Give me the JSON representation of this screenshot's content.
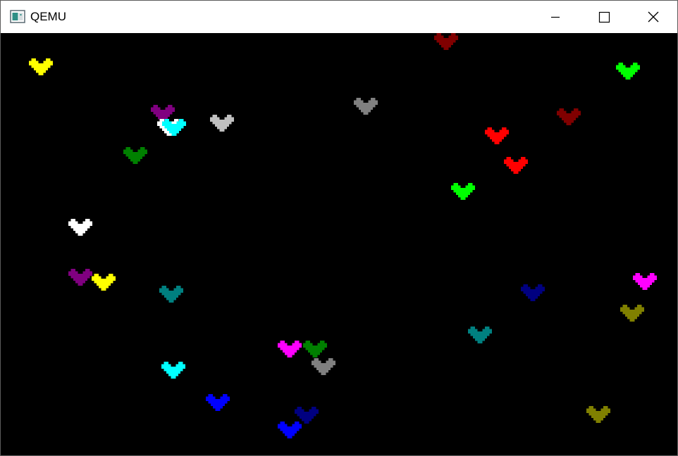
{
  "window": {
    "title": "QEMU",
    "icon": "qemu-app-icon",
    "controls": {
      "minimize_icon": "minimize-icon",
      "maximize_icon": "maximize-icon",
      "close_icon": "close-icon"
    }
  },
  "display": {
    "background": "#000000",
    "hearts": [
      {
        "color": "#FFFF00"
      },
      {
        "color": "#800000"
      },
      {
        "color": "#00FF00"
      },
      {
        "color": "#808080"
      },
      {
        "color": "#800080"
      },
      {
        "color": "#FFFFFF"
      },
      {
        "color": "#00FFFF"
      },
      {
        "color": "#C0C0C0"
      },
      {
        "color": "#800000"
      },
      {
        "color": "#FF0000"
      },
      {
        "color": "#008000"
      },
      {
        "color": "#FF0000"
      },
      {
        "color": "#00FF00"
      },
      {
        "color": "#FFFFFF"
      },
      {
        "color": "#800080"
      },
      {
        "color": "#FFFF00"
      },
      {
        "color": "#008080"
      },
      {
        "color": "#000080"
      },
      {
        "color": "#FF00FF"
      },
      {
        "color": "#808000"
      },
      {
        "color": "#008080"
      },
      {
        "color": "#FF00FF"
      },
      {
        "color": "#008000"
      },
      {
        "color": "#808080"
      },
      {
        "color": "#00FFFF"
      },
      {
        "color": "#0000FF"
      },
      {
        "color": "#000080"
      },
      {
        "color": "#0000FF"
      },
      {
        "color": "#808000"
      }
    ]
  }
}
